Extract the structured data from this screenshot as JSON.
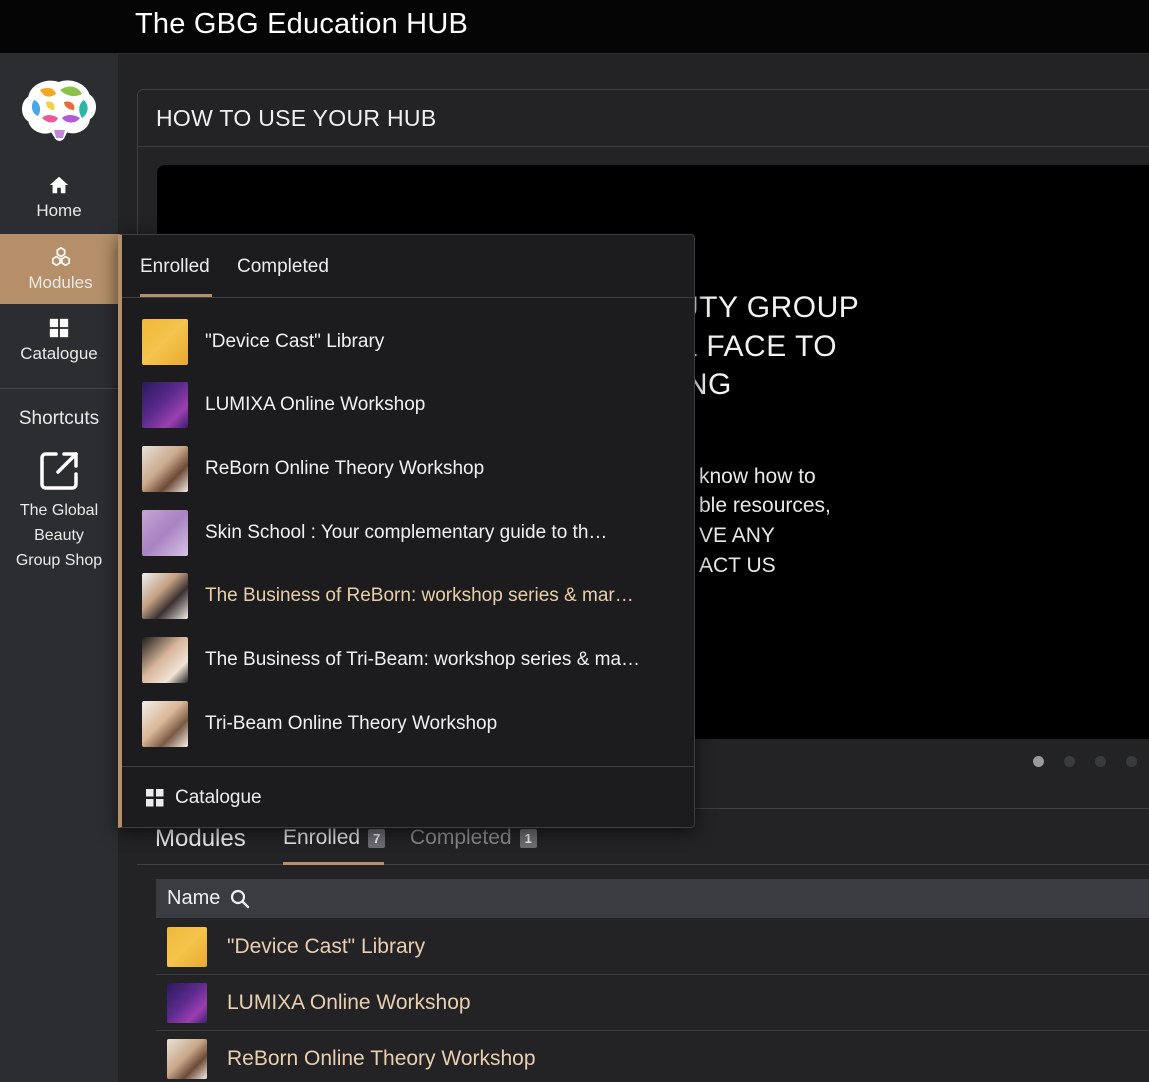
{
  "app": {
    "title": "The GBG Education HUB"
  },
  "sidebar": {
    "items": [
      {
        "label": "Home",
        "icon": "home-icon"
      },
      {
        "label": "Modules",
        "icon": "modules-icon",
        "active": true
      },
      {
        "label": "Catalogue",
        "icon": "grid-icon"
      }
    ],
    "shortcuts_label": "Shortcuts",
    "shortcut": {
      "line1": "The Global",
      "line2": "Beauty",
      "line3": "Group Shop",
      "icon": "external-link-icon"
    }
  },
  "panel": {
    "title": "HOW TO USE YOUR HUB",
    "video": {
      "head_lines": [
        "UTY GROUP",
        "& FACE TO",
        "ING"
      ],
      "body_lines": [
        "know how to",
        "ble resources,",
        "VE ANY",
        "ACT US"
      ]
    },
    "carousel_dots": 4
  },
  "dropdown": {
    "tabs": {
      "enrolled": "Enrolled",
      "completed": "Completed"
    },
    "items": [
      {
        "label": "\"Device Cast\" Library"
      },
      {
        "label": "LUMIXA Online Workshop"
      },
      {
        "label": "ReBorn Online Theory Workshop"
      },
      {
        "label": "Skin School : Your complementary guide to th…"
      },
      {
        "label": "The Business of ReBorn: workshop series & mar…"
      },
      {
        "label": "The Business of Tri-Beam: workshop series & ma…"
      },
      {
        "label": "Tri-Beam Online Theory Workshop"
      }
    ],
    "footer_label": "Catalogue"
  },
  "modules": {
    "title": "Modules",
    "tabs": {
      "enrolled": {
        "label": "Enrolled",
        "count": "7"
      },
      "completed": {
        "label": "Completed",
        "count": "1"
      }
    },
    "table": {
      "header": "Name",
      "rows": [
        {
          "name": "\"Device Cast\" Library"
        },
        {
          "name": "LUMIXA Online Workshop"
        },
        {
          "name": "ReBorn Online Theory Workshop"
        }
      ]
    }
  },
  "colors": {
    "accent": "#b48f6a",
    "topbar": "#050505",
    "sidebar": "#2c2d30",
    "background": "#232325",
    "highlight_text": "#e9cfb0"
  }
}
